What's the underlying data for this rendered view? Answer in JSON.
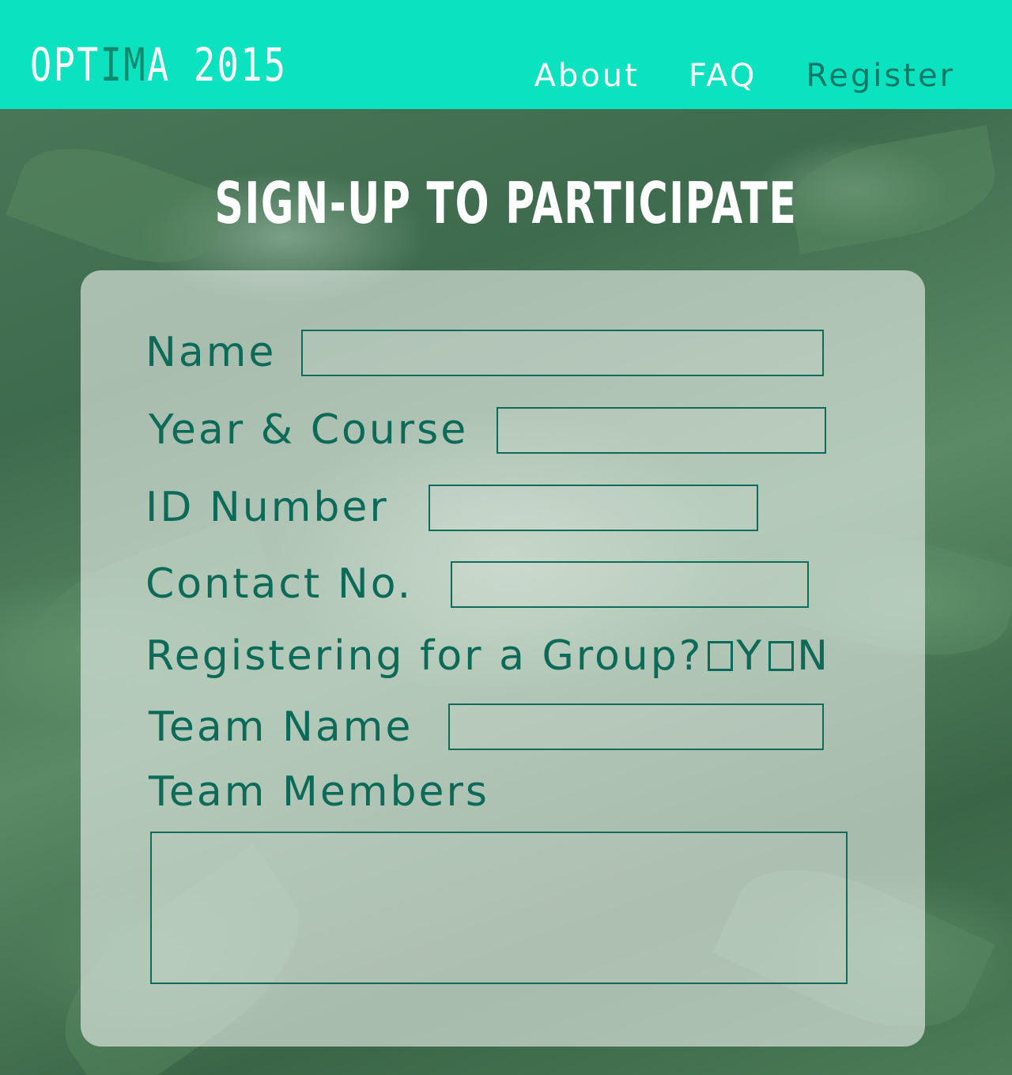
{
  "header": {
    "logo_main": "OPT",
    "logo_accent": "IM",
    "logo_end": "A 2015",
    "nav": [
      {
        "label": "About"
      },
      {
        "label": "FAQ"
      },
      {
        "label": "Register"
      }
    ]
  },
  "main": {
    "title": "SIGN-UP TO PARTICIPATE"
  },
  "form": {
    "name_label": "Name",
    "name_value": "",
    "year_course_label": "Year & Course",
    "year_course_value": "",
    "id_label": "ID Number",
    "id_value": "",
    "contact_label": "Contact No.",
    "contact_value": "",
    "group_question": "Registering for a Group?",
    "group_yes": "Y",
    "group_no": "N",
    "team_name_label": "Team Name",
    "team_name_value": "",
    "team_members_label": "Team Members",
    "team_members_value": ""
  },
  "colors": {
    "header_bg": "#0ae2c0",
    "accent_dark": "#0c6a58",
    "active_nav": "#0c7a66"
  }
}
